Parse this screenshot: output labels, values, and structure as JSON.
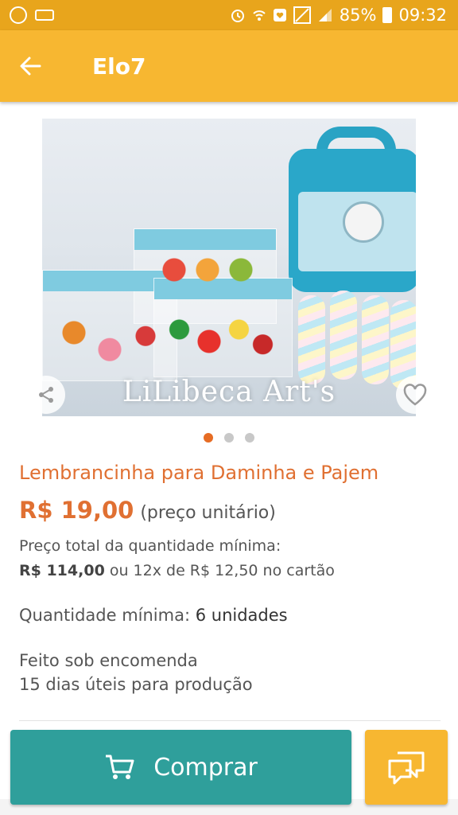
{
  "status_bar": {
    "battery": "85%",
    "time": "09:32",
    "icons": [
      "whatsapp-icon",
      "voicemail-icon",
      "alarm-icon",
      "wifi-icon",
      "notification-icon",
      "photo-icon",
      "signal-icon",
      "battery-icon"
    ]
  },
  "app_bar": {
    "title": "Elo7",
    "back_icon": "arrow-left-icon"
  },
  "product": {
    "image_watermark": "LiLibeca Art's",
    "carousel": {
      "count": 3,
      "active_index": 0
    },
    "title": "Lembrancinha para Daminha e Pajem",
    "price": "R$ 19,00",
    "price_unit": "(preço unitário)",
    "total_label": "Preço total da quantidade mínima:",
    "total_value": "R$ 114,00",
    "installments": "ou 12x de R$ 12,50 no cartão",
    "min_qty_label": "Quantidade mínima:",
    "min_qty_value": "6 unidades",
    "made_to_order": "Feito sob encomenda",
    "production_time": "15 dias úteis para produção"
  },
  "actions": {
    "buy_label": "Comprar",
    "buy_icon": "cart-icon",
    "chat_icon": "chat-icon",
    "share_icon": "share-icon",
    "favorite_icon": "heart-icon"
  },
  "colors": {
    "status_bar": "#e8a51c",
    "app_bar": "#f7b731",
    "accent_orange": "#e07032",
    "buy_button": "#2f9f9b",
    "chat_button": "#f7b731",
    "dot_active": "#e66c24",
    "dot_inactive": "#c8c8c8"
  }
}
